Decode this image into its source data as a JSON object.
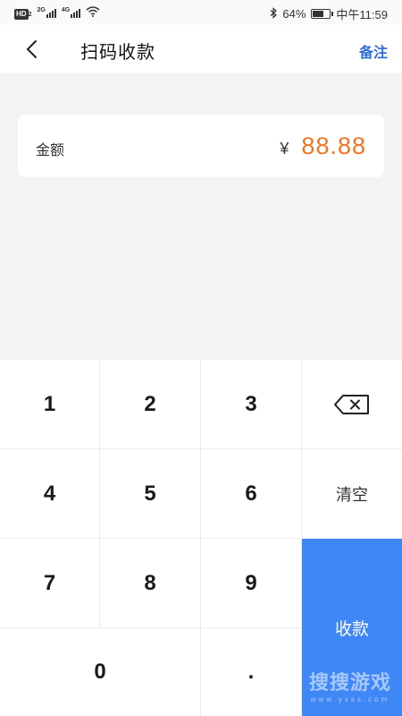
{
  "status_bar": {
    "hd": "HD",
    "hd_sub": "2",
    "net1": "2G",
    "net2": "4G",
    "battery": "64%",
    "battery_level": 0.64,
    "time": "中午11:59"
  },
  "header": {
    "title": "扫码收款",
    "note_label": "备注"
  },
  "amount": {
    "label": "金额",
    "currency": "¥",
    "value": "88.88",
    "value_color": "#ee7421"
  },
  "keypad": {
    "k1": "1",
    "k2": "2",
    "k3": "3",
    "k4": "4",
    "k5": "5",
    "k6": "6",
    "k7": "7",
    "k8": "8",
    "k9": "9",
    "k0": "0",
    "dot": ".",
    "backspace_icon": "backspace-icon",
    "clear_label": "清空",
    "submit_label": "收款",
    "submit_color": "#3f86f6"
  },
  "watermark": {
    "title": "搜搜游戏",
    "url": "www.yxss.com"
  }
}
